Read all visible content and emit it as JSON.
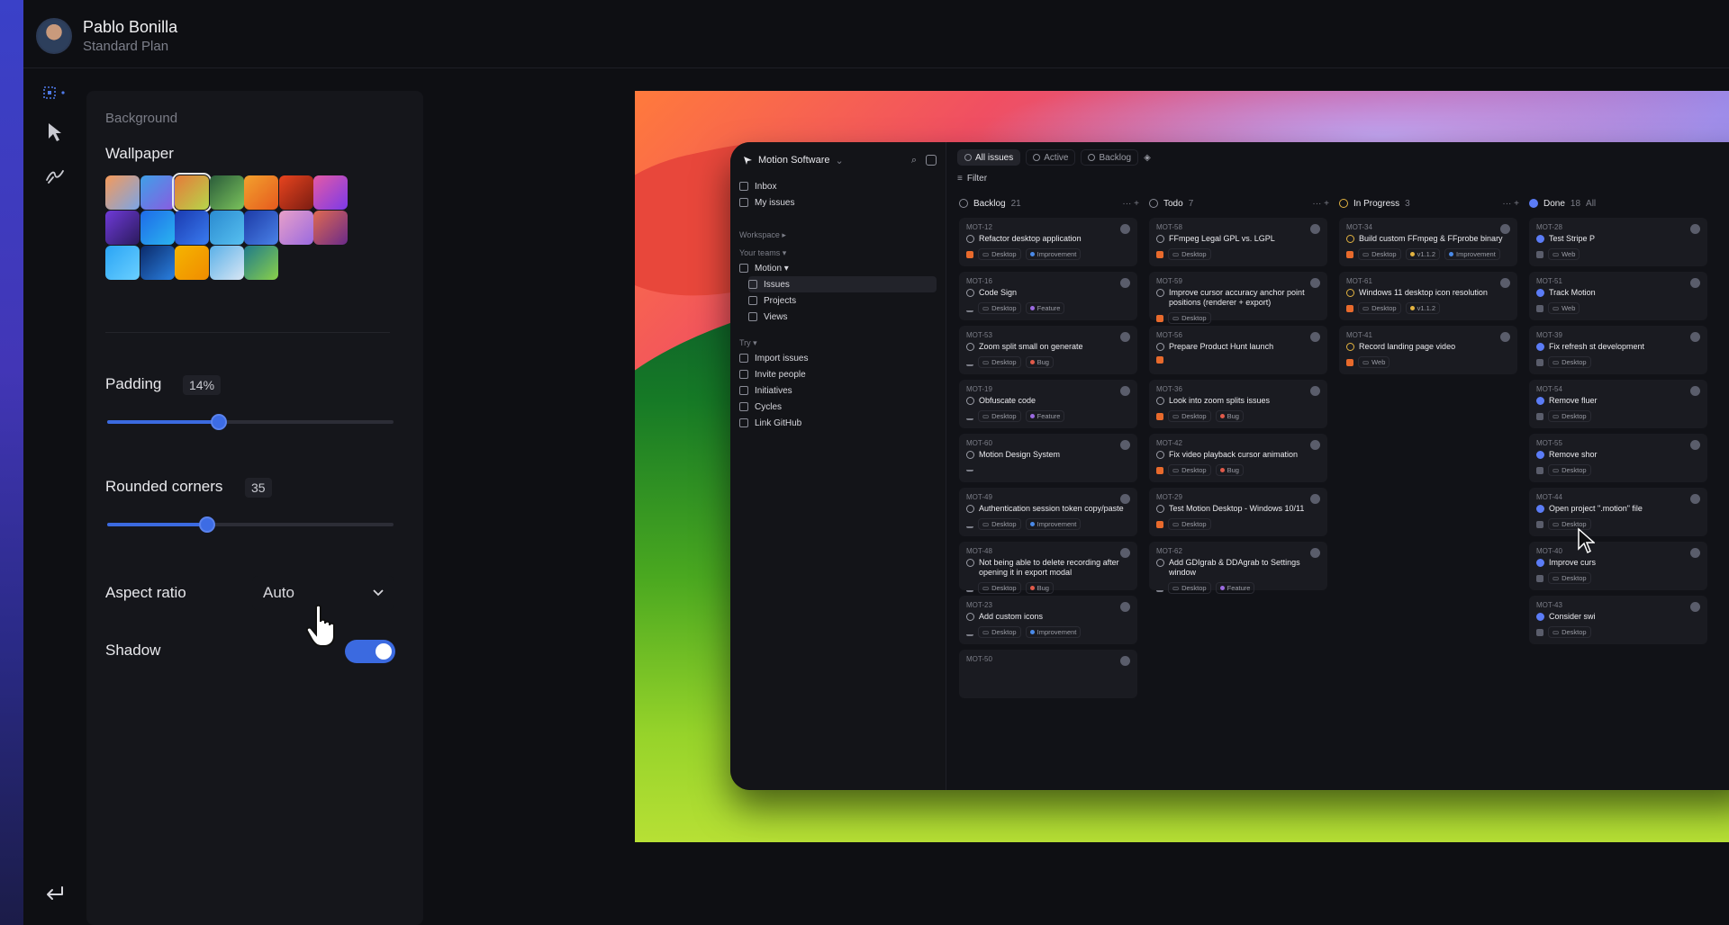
{
  "user": {
    "name": "Pablo Bonilla",
    "plan": "Standard Plan"
  },
  "toolbar": {
    "items": [
      "crop-icon",
      "pointer-icon",
      "draw-icon"
    ],
    "back_icon": "return-icon"
  },
  "panel": {
    "section_title": "Background",
    "wallpaper_label": "Wallpaper",
    "wallpapers": [
      {
        "name": "wallpaper-1",
        "colors": [
          "#f59a5a",
          "#7aa5e8"
        ],
        "selected": false
      },
      {
        "name": "wallpaper-2",
        "colors": [
          "#3fa0e8",
          "#8a5be0"
        ],
        "selected": false
      },
      {
        "name": "wallpaper-3",
        "colors": [
          "#e67a3a",
          "#b6d64a"
        ],
        "selected": true
      },
      {
        "name": "wallpaper-4",
        "colors": [
          "#2a5c3a",
          "#7bc35c"
        ],
        "selected": false
      },
      {
        "name": "wallpaper-5",
        "colors": [
          "#f2a12d",
          "#e65a1e"
        ],
        "selected": false
      },
      {
        "name": "wallpaper-6",
        "colors": [
          "#e8441e",
          "#7a1c12"
        ],
        "selected": false
      },
      {
        "name": "wallpaper-7",
        "colors": [
          "#e45aa6",
          "#7b3ae8"
        ],
        "selected": false
      },
      {
        "name": "wallpaper-8",
        "colors": [
          "#6f3ad8",
          "#2a1a5c"
        ],
        "selected": false
      },
      {
        "name": "wallpaper-9",
        "colors": [
          "#1e6ae8",
          "#2ab4f0"
        ],
        "selected": false
      },
      {
        "name": "wallpaper-10",
        "colors": [
          "#1a3ab0",
          "#3a7cf0"
        ],
        "selected": false
      },
      {
        "name": "wallpaper-11",
        "colors": [
          "#2a8ad0",
          "#57c0f0"
        ],
        "selected": false
      },
      {
        "name": "wallpaper-12",
        "colors": [
          "#1c3aa6",
          "#4a82e8"
        ],
        "selected": false
      },
      {
        "name": "wallpaper-13",
        "colors": [
          "#e8a0c8",
          "#9b6ae0"
        ],
        "selected": false
      },
      {
        "name": "wallpaper-14",
        "colors": [
          "#e06a50",
          "#6a2a8a"
        ],
        "selected": false
      },
      {
        "name": "wallpaper-15",
        "colors": [
          "#2aa4f5",
          "#6ad0ff"
        ],
        "selected": false
      },
      {
        "name": "wallpaper-16",
        "colors": [
          "#0b2a6a",
          "#2a80e0"
        ],
        "selected": false
      },
      {
        "name": "wallpaper-17",
        "colors": [
          "#f5b400",
          "#f08c00"
        ],
        "selected": false
      },
      {
        "name": "wallpaper-18",
        "colors": [
          "#5ab0e8",
          "#d8e6f4"
        ],
        "selected": false
      },
      {
        "name": "wallpaper-19",
        "colors": [
          "#1e7a8a",
          "#8ad04a"
        ],
        "selected": false
      }
    ],
    "padding": {
      "label": "Padding",
      "value": "14%",
      "fraction": 0.39
    },
    "rounded": {
      "label": "Rounded corners",
      "value": "35",
      "fraction": 0.35
    },
    "aspect": {
      "label": "Aspect ratio",
      "value": "Auto"
    },
    "shadow": {
      "label": "Shadow",
      "on": true
    }
  },
  "accent": "#3b6ae0",
  "app": {
    "workspace": "Motion Software",
    "tabs": [
      {
        "label": "All issues",
        "active": true
      },
      {
        "label": "Active",
        "active": false
      },
      {
        "label": "Backlog",
        "active": false
      }
    ],
    "filter_label": "Filter",
    "sidebar": {
      "top": [
        {
          "label": "Inbox",
          "icon": "inbox-icon"
        },
        {
          "label": "My issues",
          "icon": "issues-icon"
        }
      ],
      "workspace_cap": "Workspace",
      "teams_cap": "Your teams",
      "team": "Motion",
      "team_items": [
        {
          "label": "Issues",
          "active": true
        },
        {
          "label": "Projects",
          "active": false
        },
        {
          "label": "Views",
          "active": false
        }
      ],
      "try_cap": "Try",
      "try_items": [
        "Import issues",
        "Invite people",
        "Initiatives",
        "Cycles",
        "Link GitHub"
      ]
    },
    "columns": [
      {
        "name": "Backlog",
        "count": "21",
        "status": "open",
        "cards": [
          {
            "id": "MOT-12",
            "title": "Refactor desktop application",
            "pri": "urgent",
            "tags": [
              {
                "t": "Desktop"
              },
              {
                "t": "Improvement",
                "c": "#4a8ae8"
              }
            ]
          },
          {
            "id": "MOT-16",
            "title": "Code Sign",
            "pri": "bars",
            "tags": [
              {
                "t": "Desktop"
              },
              {
                "t": "Feature",
                "c": "#9b6ae0"
              }
            ]
          },
          {
            "id": "MOT-53",
            "title": "Zoom split small on generate",
            "pri": "bars",
            "tags": [
              {
                "t": "Desktop"
              },
              {
                "t": "Bug",
                "c": "#e05a4a"
              }
            ]
          },
          {
            "id": "MOT-19",
            "title": "Obfuscate code",
            "pri": "bars",
            "tags": [
              {
                "t": "Desktop"
              },
              {
                "t": "Feature",
                "c": "#9b6ae0"
              }
            ]
          },
          {
            "id": "MOT-60",
            "title": "Motion Design System",
            "pri": "bars",
            "tags": []
          },
          {
            "id": "MOT-49",
            "title": "Authentication session token copy/paste",
            "pri": "bars",
            "tags": [
              {
                "t": "Desktop"
              },
              {
                "t": "Improvement",
                "c": "#4a8ae8"
              }
            ]
          },
          {
            "id": "MOT-48",
            "title": "Not being able to delete recording after opening it in export modal",
            "pri": "bars",
            "tags": [
              {
                "t": "Desktop"
              },
              {
                "t": "Bug",
                "c": "#e05a4a"
              }
            ]
          },
          {
            "id": "MOT-23",
            "title": "Add custom icons",
            "pri": "bars",
            "tags": [
              {
                "t": "Desktop"
              },
              {
                "t": "Improvement",
                "c": "#4a8ae8"
              }
            ]
          },
          {
            "id": "MOT-50",
            "title": "",
            "pri": "",
            "tags": []
          }
        ]
      },
      {
        "name": "Todo",
        "count": "7",
        "status": "open",
        "cards": [
          {
            "id": "MOT-58",
            "title": "FFmpeg Legal GPL vs. LGPL",
            "pri": "urgent",
            "tags": [
              {
                "t": "Desktop"
              }
            ]
          },
          {
            "id": "MOT-59",
            "title": "Improve cursor accuracy anchor point positions (renderer + export)",
            "pri": "urgent",
            "tags": [
              {
                "t": "Desktop"
              }
            ]
          },
          {
            "id": "MOT-56",
            "title": "Prepare Product Hunt launch",
            "pri": "urgent",
            "tags": []
          },
          {
            "id": "MOT-36",
            "title": "Look into zoom splits issues",
            "pri": "urgent",
            "tags": [
              {
                "t": "Desktop"
              },
              {
                "t": "Bug",
                "c": "#e05a4a"
              }
            ]
          },
          {
            "id": "MOT-42",
            "title": "Fix video playback cursor animation",
            "pri": "urgent",
            "tags": [
              {
                "t": "Desktop"
              },
              {
                "t": "Bug",
                "c": "#e05a4a"
              }
            ]
          },
          {
            "id": "MOT-29",
            "title": "Test Motion Desktop - Windows 10/11",
            "pri": "urgent",
            "tags": [
              {
                "t": "Desktop"
              }
            ]
          },
          {
            "id": "MOT-62",
            "title": "Add GDIgrab & DDAgrab to Settings window",
            "pri": "bars",
            "tags": [
              {
                "t": "Desktop"
              },
              {
                "t": "Feature",
                "c": "#9b6ae0"
              }
            ]
          }
        ]
      },
      {
        "name": "In Progress",
        "count": "3",
        "status": "prog",
        "cards": [
          {
            "id": "MOT-34",
            "title": "Build custom FFmpeg & FFprobe binary",
            "pri": "urgent",
            "tags": [
              {
                "t": "Desktop"
              },
              {
                "t": "v1.1.2",
                "c": "#e3b341"
              },
              {
                "t": "Improvement",
                "c": "#4a8ae8"
              }
            ]
          },
          {
            "id": "MOT-61",
            "title": "Windows 11 desktop icon resolution",
            "pri": "urgent",
            "tags": [
              {
                "t": "Desktop"
              },
              {
                "t": "v1.1.2",
                "c": "#e3b341"
              }
            ]
          },
          {
            "id": "MOT-41",
            "title": "Record landing page video",
            "pri": "urgent",
            "tags": [
              {
                "t": "Web"
              }
            ]
          }
        ]
      },
      {
        "name": "Done",
        "count": "18",
        "status": "done",
        "extra": "All",
        "cards": [
          {
            "id": "MOT-28",
            "title": "Test Stripe P",
            "pri": "gray",
            "tags": [
              {
                "t": "Web"
              }
            ]
          },
          {
            "id": "MOT-51",
            "title": "Track Motion",
            "pri": "gray",
            "tags": [
              {
                "t": "Web"
              }
            ]
          },
          {
            "id": "MOT-39",
            "title": "Fix refresh st development",
            "pri": "gray",
            "tags": [
              {
                "t": "Desktop"
              }
            ]
          },
          {
            "id": "MOT-54",
            "title": "Remove fluer",
            "pri": "gray",
            "tags": [
              {
                "t": "Desktop"
              }
            ]
          },
          {
            "id": "MOT-55",
            "title": "Remove shor",
            "pri": "gray",
            "tags": [
              {
                "t": "Desktop"
              }
            ]
          },
          {
            "id": "MOT-44",
            "title": "Open project \".motion\" file",
            "pri": "gray",
            "tags": [
              {
                "t": "Desktop"
              }
            ]
          },
          {
            "id": "MOT-40",
            "title": "Improve curs",
            "pri": "gray",
            "tags": [
              {
                "t": "Desktop"
              }
            ]
          },
          {
            "id": "MOT-43",
            "title": "Consider swi",
            "pri": "gray",
            "tags": [
              {
                "t": "Desktop"
              }
            ]
          }
        ]
      }
    ]
  }
}
